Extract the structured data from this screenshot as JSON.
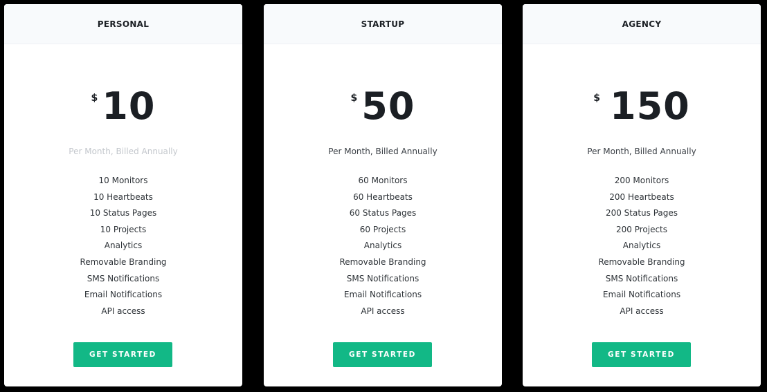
{
  "colors": {
    "background": "#000000",
    "card": "#ffffff",
    "header": "#f8fafc",
    "accent": "#12b886",
    "text_dark": "#1b1f24",
    "text_muted": "#c3c7cc"
  },
  "plans": [
    {
      "name": "PERSONAL",
      "currency": "$",
      "price": "10",
      "billing": "Per Month, Billed Annually",
      "features": [
        "10 Monitors",
        "10 Heartbeats",
        "10 Status Pages",
        "10 Projects",
        "Analytics",
        "Removable Branding",
        "SMS Notifications",
        "Email Notifications",
        "API access"
      ],
      "cta": "GET STARTED"
    },
    {
      "name": "STARTUP",
      "currency": "$",
      "price": "50",
      "billing": "Per Month, Billed Annually",
      "features": [
        "60 Monitors",
        "60 Heartbeats",
        "60 Status Pages",
        "60 Projects",
        "Analytics",
        "Removable Branding",
        "SMS Notifications",
        "Email Notifications",
        "API access"
      ],
      "cta": "GET STARTED"
    },
    {
      "name": "AGENCY",
      "currency": "$",
      "price": "150",
      "billing": "Per Month, Billed Annually",
      "features": [
        "200 Monitors",
        "200 Heartbeats",
        "200 Status Pages",
        "200 Projects",
        "Analytics",
        "Removable Branding",
        "SMS Notifications",
        "Email Notifications",
        "API access"
      ],
      "cta": "GET STARTED"
    }
  ]
}
